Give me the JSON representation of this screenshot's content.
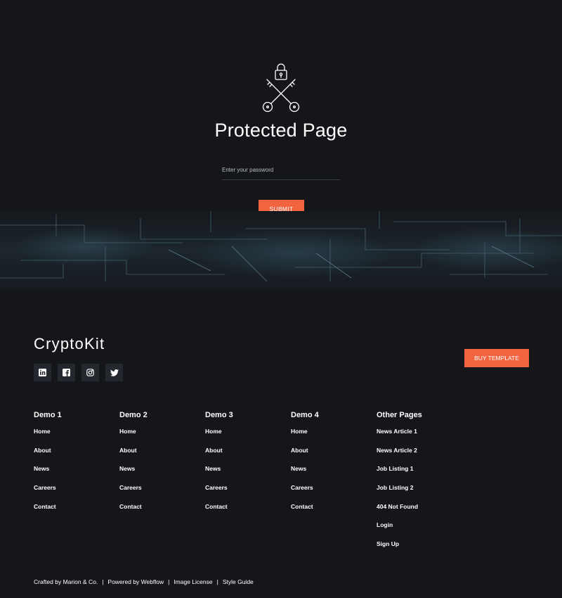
{
  "protected": {
    "title": "Protected Page",
    "password_placeholder": "Enter your password",
    "submit_label": "SUBMIT"
  },
  "footer": {
    "brand": "CryptoKit",
    "buy_label": "BUY TEMPLATE",
    "socials": [
      "linkedin-icon",
      "facebook-icon",
      "instagram-icon",
      "twitter-icon"
    ],
    "columns": [
      {
        "heading": "Demo 1",
        "links": [
          "Home",
          "About",
          "News",
          "Careers",
          "Contact"
        ]
      },
      {
        "heading": "Demo 2",
        "links": [
          "Home",
          "About",
          "News",
          "Careers",
          "Contact"
        ]
      },
      {
        "heading": "Demo 3",
        "links": [
          "Home",
          "About",
          "News",
          "Careers",
          "Contact"
        ]
      },
      {
        "heading": "Demo 4",
        "links": [
          "Home",
          "About",
          "News",
          "Careers",
          "Contact"
        ]
      },
      {
        "heading": "Other Pages",
        "links": [
          "News Article 1",
          "News Article 2",
          "Job Listing 1",
          "Job Listing 2",
          "404 Not Found",
          "Login",
          "Sign Up"
        ]
      }
    ],
    "credits": {
      "crafted": "Crafted by Marion & Co.",
      "powered": "Powered by Webflow",
      "license": "Image License",
      "style": "Style Guide",
      "separator": "|"
    }
  },
  "colors": {
    "background": "#141619",
    "accent": "#f2643f",
    "social_bg": "#24282e"
  }
}
